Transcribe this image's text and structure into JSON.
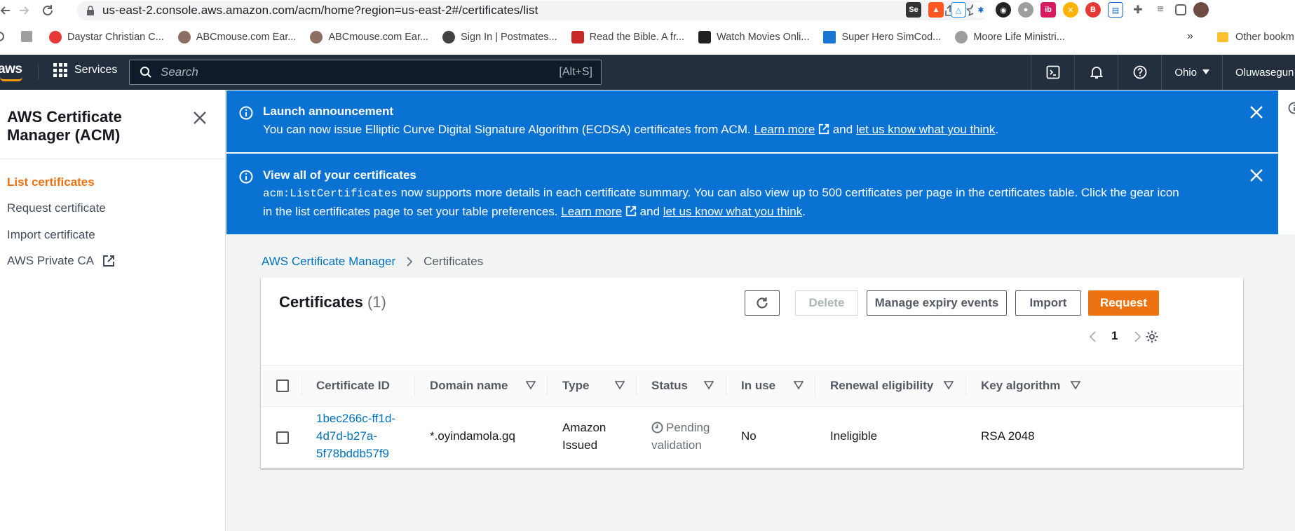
{
  "browser": {
    "url": "us-east-2.console.aws.amazon.com/acm/home?region=us-east-2#/certificates/list",
    "bookmarks": [
      {
        "label": "Daystar Christian C...",
        "color": "#e53935"
      },
      {
        "label": "ABCmouse.com Ear...",
        "color": "#8d6e63"
      },
      {
        "label": "ABCmouse.com Ear...",
        "color": "#8d6e63"
      },
      {
        "label": "Sign In | Postmates...",
        "color": "#424242"
      },
      {
        "label": "Read the Bible. A fr...",
        "color": "#c62828"
      },
      {
        "label": "Watch Movies Onli...",
        "color": "#212121"
      },
      {
        "label": "Super Hero SimCod...",
        "color": "#1976d2"
      },
      {
        "label": "Moore Life Ministri...",
        "color": "#9e9e9e"
      }
    ],
    "other_bookmarks": "Other bookm",
    "overflow": "»"
  },
  "awsnav": {
    "logo": "aws",
    "services": "Services",
    "search_placeholder": "Search",
    "search_shortcut": "[Alt+S]",
    "region": "Ohio",
    "account": "Oluwasegun"
  },
  "sidebar": {
    "title": "AWS Certificate Manager (ACM)",
    "items": [
      {
        "label": "List certificates",
        "active": true
      },
      {
        "label": "Request certificate",
        "active": false
      },
      {
        "label": "Import certificate",
        "active": false
      },
      {
        "label": "AWS Private CA",
        "active": false
      }
    ]
  },
  "flash": [
    {
      "title": "Launch announcement",
      "body_1": "You can now issue Elliptic Curve Digital Signature Algorithm (ECDSA) certificates from ACM.",
      "learn_more": "Learn more",
      "and": "and",
      "feedback": "let us know what you think",
      "period": "."
    },
    {
      "title": "View all of your certificates",
      "code": "acm:ListCertificates",
      "body_1": "now supports more details in each certificate summary. You can also view up to 500 certificates per page in the certificates table. Click the gear icon",
      "body_2": "in the list certificates page to set your table preferences.",
      "learn_more": "Learn more",
      "and": "and",
      "feedback": "let us know what you think",
      "period": "."
    }
  ],
  "breadcrumb": {
    "root": "AWS Certificate Manager",
    "current": "Certificates"
  },
  "panel": {
    "title": "Certificates",
    "count": "(1)",
    "buttons": {
      "delete": "Delete",
      "manage_expiry": "Manage expiry events",
      "import": "Import",
      "request": "Request"
    },
    "page": "1"
  },
  "table": {
    "columns": [
      "Certificate ID",
      "Domain name",
      "Type",
      "Status",
      "In use",
      "Renewal eligibility",
      "Key algorithm"
    ],
    "rows": [
      {
        "id_1": "1bec266c-ff1d-",
        "id_2": "4d7d-b27a-",
        "id_3": "5f78bddb57f9",
        "domain": "*.oyindamola.gq",
        "type_1": "Amazon",
        "type_2": "Issued",
        "status_1": "Pending",
        "status_2": "validation",
        "in_use": "No",
        "renewal": "Ineligible",
        "key_algorithm": "RSA 2048"
      }
    ]
  },
  "colors": {
    "aws_nav": "#232f3e",
    "flash_blue": "#0972d3",
    "primary_orange": "#ec7211",
    "link_blue": "#0073bb"
  }
}
